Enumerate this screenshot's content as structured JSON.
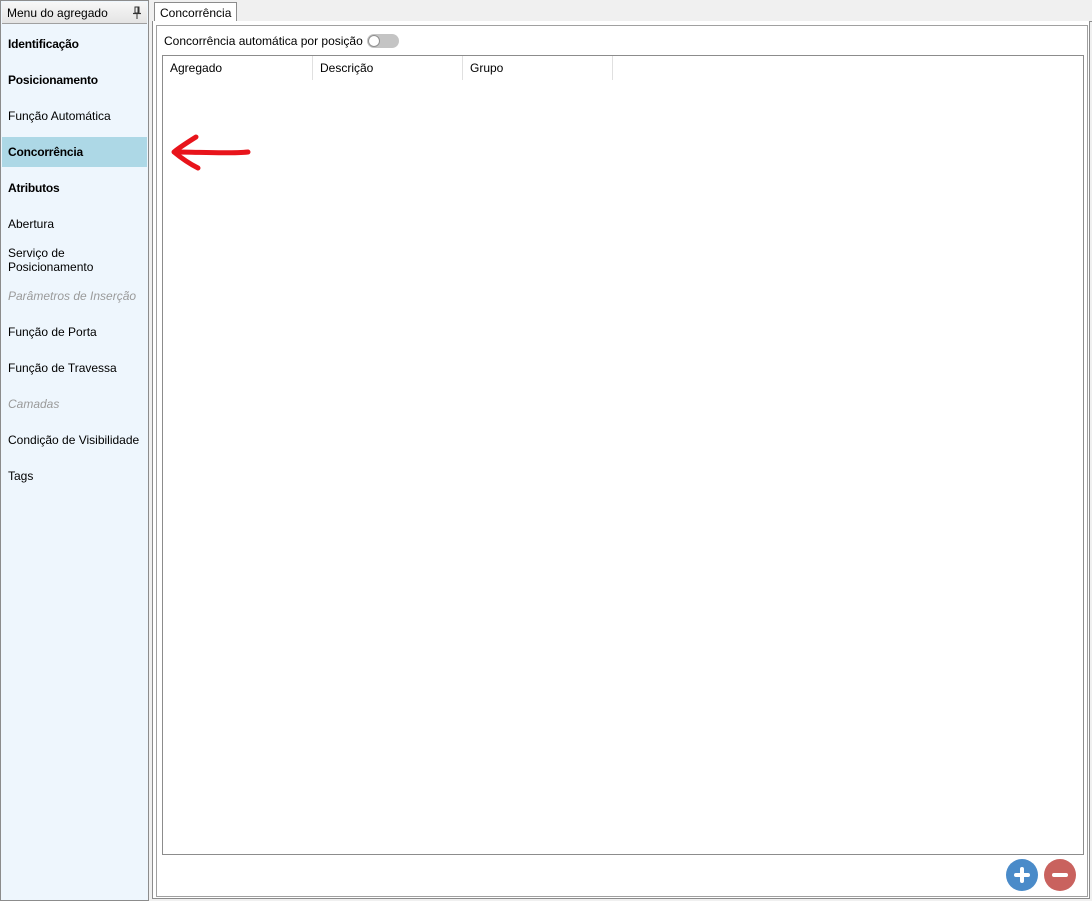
{
  "sidebar": {
    "title": "Menu do agregado",
    "items": [
      {
        "label": "Identificação",
        "style": "bold"
      },
      {
        "label": "Posicionamento",
        "style": "bold"
      },
      {
        "label": "Função Automática",
        "style": "normal"
      },
      {
        "label": "Concorrência",
        "style": "bold",
        "selected": true
      },
      {
        "label": "Atributos",
        "style": "bold"
      },
      {
        "label": "Abertura",
        "style": "normal"
      },
      {
        "label": "Serviço de Posicionamento",
        "style": "normal"
      },
      {
        "label": "Parâmetros de Inserção",
        "style": "disabled"
      },
      {
        "label": "Função de Porta",
        "style": "normal"
      },
      {
        "label": "Função de Travessa",
        "style": "normal"
      },
      {
        "label": "Camadas",
        "style": "disabled"
      },
      {
        "label": "Condição de Visibilidade",
        "style": "normal"
      },
      {
        "label": "Tags",
        "style": "normal"
      }
    ]
  },
  "tabs": [
    {
      "label": "Concorrência",
      "active": true
    }
  ],
  "panel": {
    "toggle_label": "Concorrência automática por posição",
    "toggle_on": false
  },
  "grid": {
    "columns": [
      "Agregado",
      "Descrição",
      "Grupo"
    ],
    "rows": []
  },
  "icons": {
    "pin": "pin-icon",
    "add": "plus-icon",
    "remove": "minus-icon",
    "arrow": "arrow-left-icon"
  },
  "colors": {
    "selected_item": "#add8e6",
    "sidebar_bg": "#eef6fd",
    "add_button": "#4a8bc9",
    "remove_button": "#c9625e",
    "annotation_arrow": "#e8141b"
  }
}
